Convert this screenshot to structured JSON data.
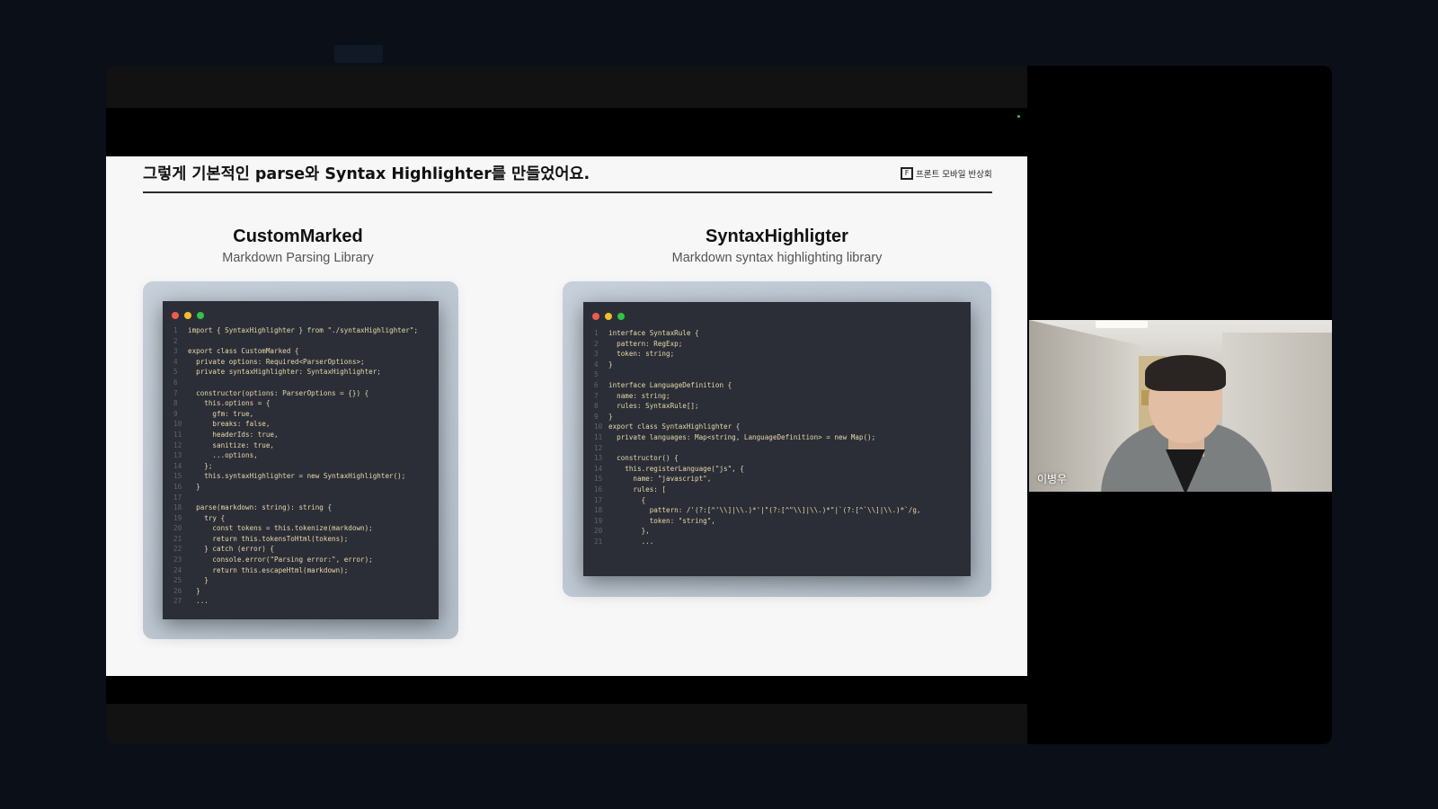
{
  "slide": {
    "title": "그렇게 기본적인 parse와 Syntax Highlighter를 만들었어요.",
    "logo_text": "프론트 모바일 반상회"
  },
  "left_column": {
    "heading": "CustomMarked",
    "subheading": "Markdown Parsing Library",
    "code_lines": [
      "import { SyntaxHighlighter } from \"./syntaxHighlighter\";",
      "",
      "export class CustomMarked {",
      "  private options: Required<ParserOptions>;",
      "  private syntaxHighlighter: SyntaxHighlighter;",
      "",
      "  constructor(options: ParserOptions = {}) {",
      "    this.options = {",
      "      gfm: true,",
      "      breaks: false,",
      "      headerIds: true,",
      "      sanitize: true,",
      "      ...options,",
      "    };",
      "    this.syntaxHighlighter = new SyntaxHighlighter();",
      "  }",
      "",
      "  parse(markdown: string): string {",
      "    try {",
      "      const tokens = this.tokenize(markdown);",
      "      return this.tokensToHtml(tokens);",
      "    } catch (error) {",
      "      console.error(\"Parsing error:\", error);",
      "      return this.escapeHtml(markdown);",
      "    }",
      "  }",
      "  ..."
    ]
  },
  "right_column": {
    "heading": "SyntaxHighligter",
    "subheading": "Markdown syntax highlighting library",
    "code_lines": [
      "interface SyntaxRule {",
      "  pattern: RegExp;",
      "  token: string;",
      "}",
      "",
      "interface LanguageDefinition {",
      "  name: string;",
      "  rules: SyntaxRule[];",
      "}",
      "export class SyntaxHighlighter {",
      "  private languages: Map<string, LanguageDefinition> = new Map();",
      "",
      "  constructor() {",
      "    this.registerLanguage(\"js\", {",
      "      name: \"javascript\",",
      "      rules: [",
      "        {",
      "          pattern: /'(?:[^'\\\\]|\\\\.)*'|\"(?:[^\"\\\\]|\\\\.)*\"|`(?:[^`\\\\]|\\\\.)*`/g,",
      "          token: \"string\",",
      "        },",
      "        ..."
    ]
  },
  "video": {
    "participant_name": "이병우"
  },
  "colors": {
    "background": "#0b0f17",
    "slide_bg": "#f7f7f8",
    "editor_bg": "#2b2e37",
    "code_text": "#e7d9a8"
  }
}
